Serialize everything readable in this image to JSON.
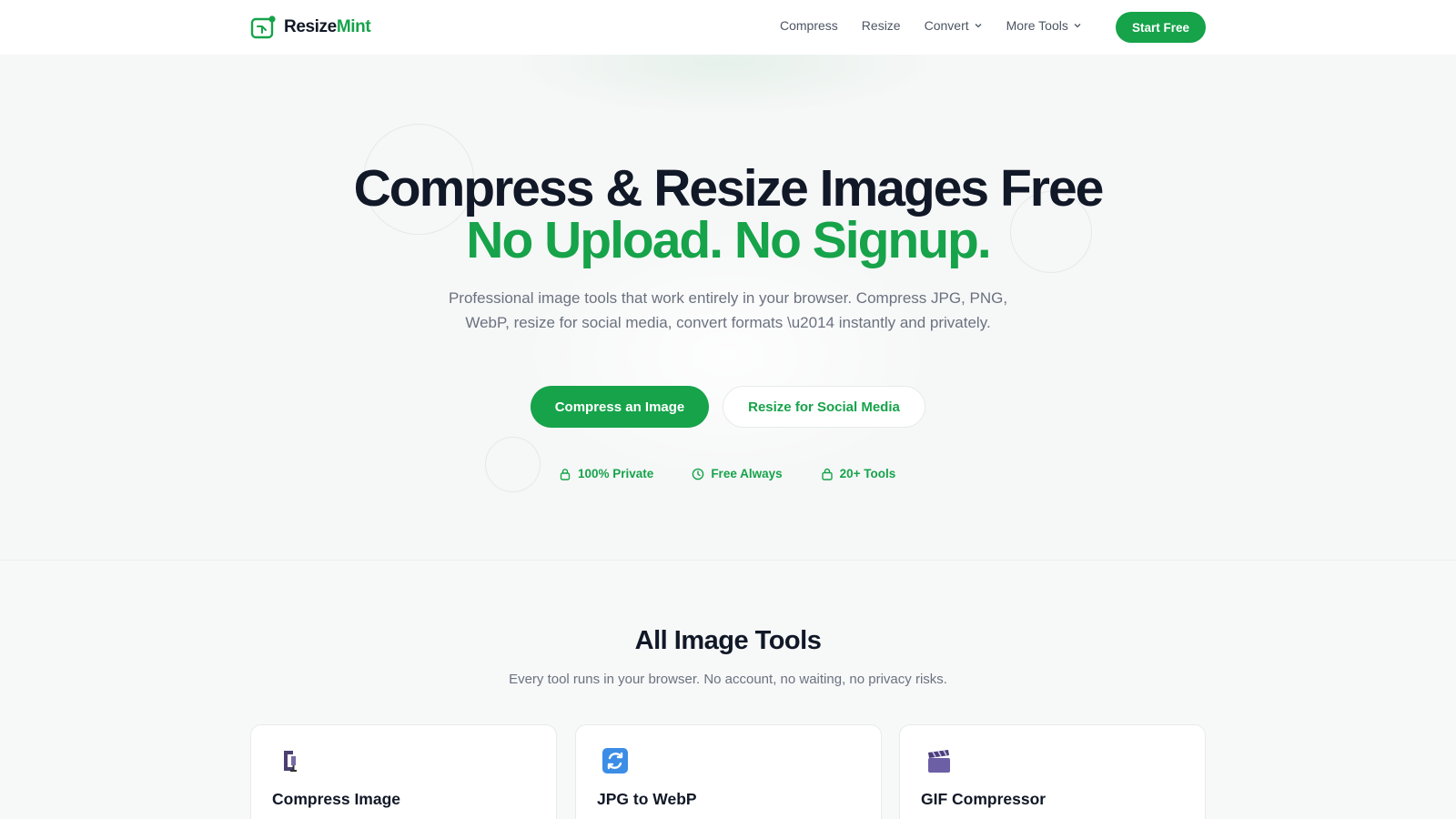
{
  "nav": {
    "logo_text_dark": "Resize",
    "logo_text_green": "Mint",
    "links": [
      {
        "label": "Compress"
      },
      {
        "label": "Resize"
      },
      {
        "label": "Convert"
      },
      {
        "label": "More Tools"
      }
    ],
    "cta_label": "Start Free"
  },
  "hero": {
    "title": "Compress & Resize Images Free",
    "title_green": "No Upload. No Signup.",
    "subtitle": "Professional image tools that work entirely in your browser. Compress JPG, PNG, WebP, resize for social media, convert formats \\u2014 instantly and privately.",
    "primary_button": "Compress an Image",
    "secondary_button": "Resize for Social Media",
    "badges": [
      {
        "label": "100% Private",
        "icon": "lock-icon"
      },
      {
        "label": "Free Always",
        "icon": "clock-icon"
      },
      {
        "label": "20+ Tools",
        "icon": "bag-icon"
      }
    ]
  },
  "tools": {
    "title": "All Image Tools",
    "subtitle": "Every tool runs in your browser. No account, no waiting, no privacy risks.",
    "cards": [
      {
        "title": "Compress Image",
        "icon": "clamp-icon"
      },
      {
        "title": "JPG to WebP",
        "icon": "refresh-icon"
      },
      {
        "title": "GIF Compressor",
        "icon": "clapper-icon"
      }
    ]
  },
  "colors": {
    "brand": "#16a34a",
    "text": "#111827",
    "muted": "#6b7280"
  }
}
